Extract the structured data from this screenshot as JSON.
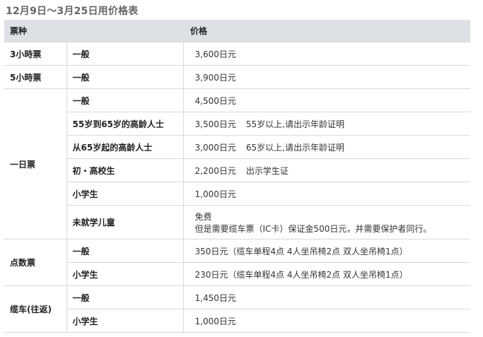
{
  "title": "12月9日～3月25日用价格表",
  "header": {
    "type": "票种",
    "price": "价格"
  },
  "rows": {
    "r0": {
      "cat": "3小時票",
      "sub": "一般",
      "price": "3,600日元"
    },
    "r1": {
      "cat": "5小時票",
      "sub": "一般",
      "price": "3,900日元"
    },
    "day": {
      "cat": "一日票",
      "r0": {
        "sub": "一般",
        "price": "4,500日元"
      },
      "r1": {
        "sub": "55岁到65岁的高龄人士",
        "price": "3,500日元",
        "note": "55岁以上,请出示年龄证明"
      },
      "r2": {
        "sub": "从65岁起的高龄人士",
        "price": "3,000日元",
        "note": "65岁以上,请出示年龄证明"
      },
      "r3": {
        "sub": "初・高校生",
        "price": "2,200日元",
        "note": "出示学生证"
      },
      "r4": {
        "sub": "小学生",
        "price": "1,000日元"
      },
      "r5": {
        "sub": "未就学儿童",
        "price": "免费",
        "price2": "但是需要缆车票（IC卡）保证金500日元，并需要保护者同行。"
      }
    },
    "points": {
      "cat": "点数票",
      "r0": {
        "sub": "一般",
        "price": "350日元（缆车单程4点 4人坐吊椅2点 双人坐吊椅1点）"
      },
      "r1": {
        "sub": "小学生",
        "price": "230日元（缆车单程4点 4人坐吊椅2点 双人坐吊椅1点）"
      }
    },
    "gondola": {
      "cat": "缆车(往返)",
      "r0": {
        "sub": "一般",
        "price": "1,450日元"
      },
      "r1": {
        "sub": "小学生",
        "price": "1,000日元"
      }
    }
  }
}
